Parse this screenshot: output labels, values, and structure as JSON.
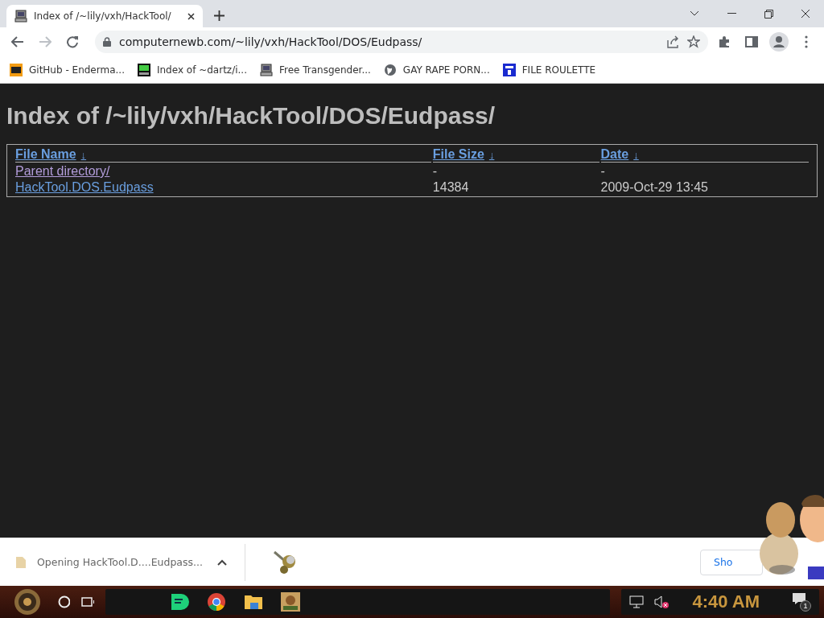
{
  "tab": {
    "title": "Index of /~lily/vxh/HackTool/",
    "selected": true
  },
  "address_bar": {
    "url": "computernewb.com/~lily/vxh/HackTool/DOS/Eudpass/"
  },
  "bookmarks": [
    {
      "label": "GitHub - Enderma...",
      "kind": "badge"
    },
    {
      "label": "Index of ~dartz/i...",
      "kind": "grid"
    },
    {
      "label": "Free Transgender...",
      "kind": "computer"
    },
    {
      "label": "GAY RAPE PORN...",
      "kind": "globe"
    },
    {
      "label": "FILE ROULETTE",
      "kind": "tile"
    }
  ],
  "page": {
    "heading": "Index of /~lily/vxh/HackTool/DOS/Eudpass/",
    "columns": [
      {
        "label": "File Name",
        "sort_mark": "↓"
      },
      {
        "label": "File Size",
        "sort_mark": "↓"
      },
      {
        "label": "Date",
        "sort_mark": "↓"
      }
    ],
    "rows": [
      {
        "name": "Parent directory/",
        "size": "-",
        "date": "-",
        "visited": true
      },
      {
        "name": "HackTool.DOS.Eudpass",
        "size": "14384",
        "date": "2009-Oct-29 13:45",
        "visited": false
      }
    ]
  },
  "download_bar": {
    "item": "Opening HackTool.D....Eudpass...",
    "button": "Sho"
  },
  "taskbar": {
    "clock": "4:40 AM",
    "notification_count": "1",
    "sound_muted": true
  }
}
